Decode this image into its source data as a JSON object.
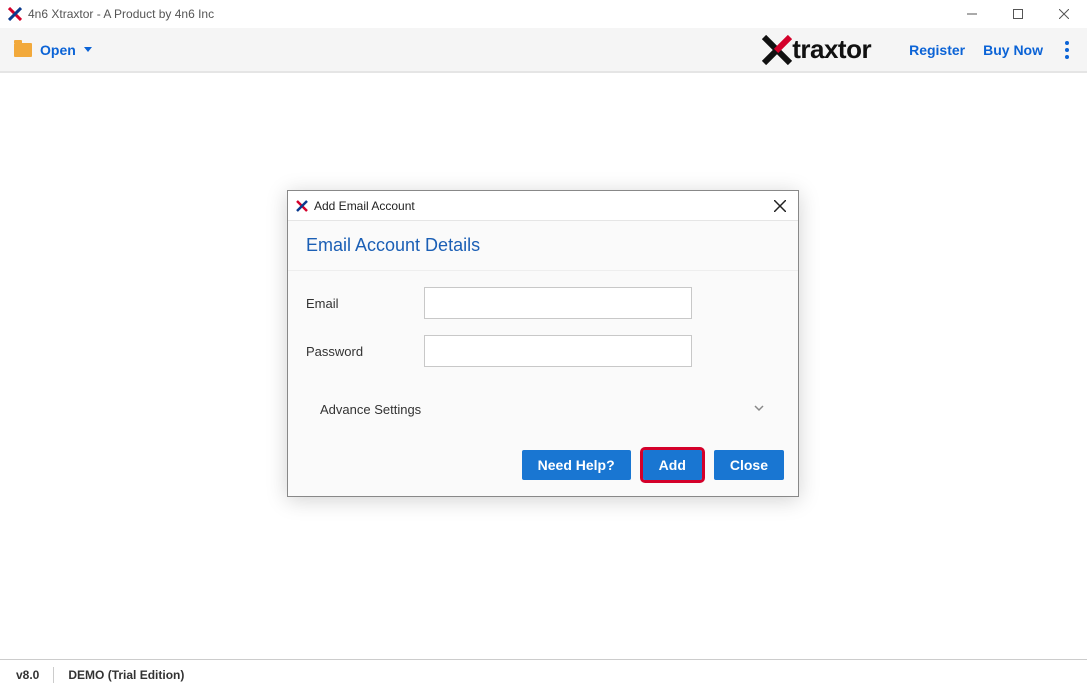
{
  "titlebar": {
    "title": "4n6 Xtraxtor - A Product by 4n6 Inc"
  },
  "toolbar": {
    "open_label": "Open",
    "register_label": "Register",
    "buy_now_label": "Buy Now",
    "brand_name": "traxtor"
  },
  "dialog": {
    "title": "Add Email Account",
    "section_title": "Email Account Details",
    "email_label": "Email",
    "email_value": "",
    "password_label": "Password",
    "password_value": "",
    "advance_label": "Advance Settings",
    "need_help_label": "Need Help?",
    "add_label": "Add",
    "close_label": "Close"
  },
  "statusbar": {
    "version": "v8.0",
    "edition": "DEMO (Trial Edition)"
  }
}
